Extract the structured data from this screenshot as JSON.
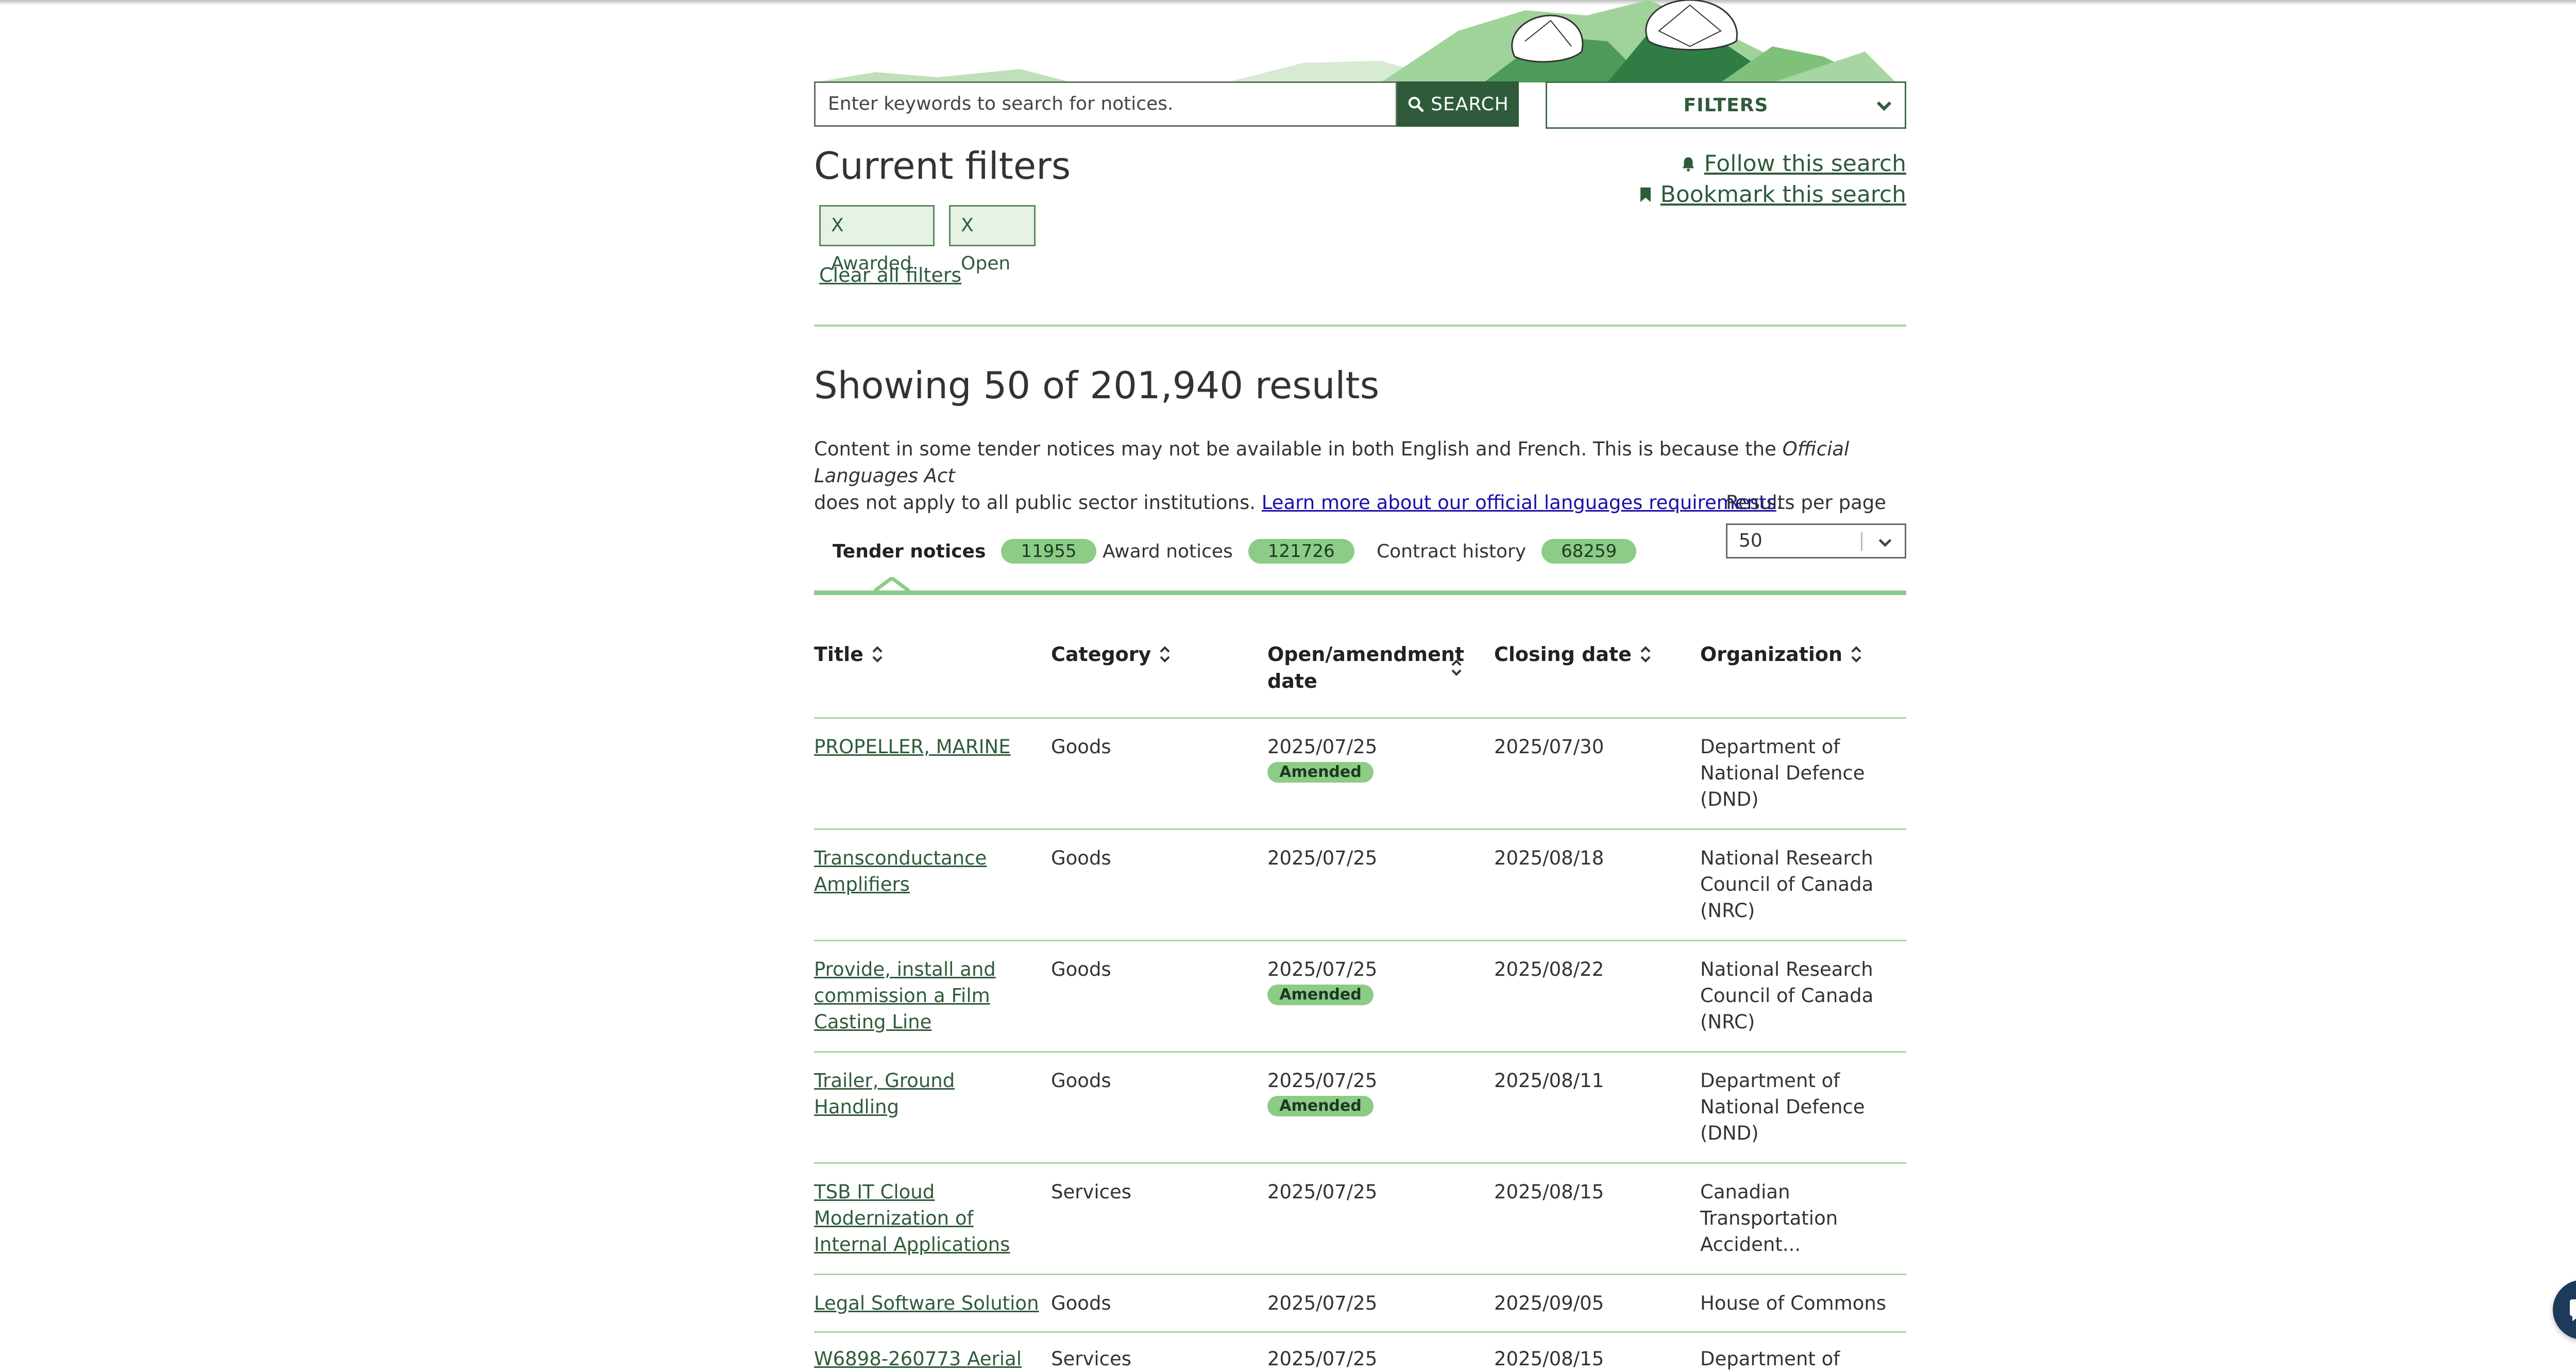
{
  "search": {
    "placeholder": "Enter keywords to search for notices.",
    "button_label": "SEARCH"
  },
  "filters_button": "FILTERS",
  "current_filters": {
    "title": "Current filters",
    "chips": [
      "X Awarded",
      "X Open"
    ],
    "clear_label": "Clear all filters",
    "follow_label": "Follow this search",
    "bookmark_label": "Bookmark this search"
  },
  "results": {
    "heading": "Showing 50 of 201,940 results",
    "notice_part1": "Content in some tender notices may not be available in both English and French. This is because the ",
    "notice_italic": "Official Languages Act",
    "notice_part2": " does not apply to all public sector institutions. ",
    "notice_link": "Learn more about our official languages requirements",
    "notice_end": ".",
    "per_page_label": "Results per page",
    "per_page_value": "50"
  },
  "tabs": [
    {
      "label": "Tender notices",
      "count": "11955",
      "active": true
    },
    {
      "label": "Award notices",
      "count": "121726",
      "active": false
    },
    {
      "label": "Contract history",
      "count": "68259",
      "active": false
    }
  ],
  "table": {
    "headers": [
      "Title",
      "Category",
      "Open/amendment date",
      "Closing date",
      "Organization"
    ],
    "amended_label": "Amended",
    "rows": [
      {
        "title": "PROPELLER, MARINE",
        "category": "Goods",
        "open_date": "2025/07/25",
        "amended": true,
        "closing": "2025/07/30",
        "org": "Department of National Defence (DND)"
      },
      {
        "title": "Transconductance Amplifiers",
        "category": "Goods",
        "open_date": "2025/07/25",
        "amended": false,
        "closing": "2025/08/18",
        "org": "National Research Council of Canada (NRC)"
      },
      {
        "title": "Provide, install and commission a Film Casting Line",
        "category": "Goods",
        "open_date": "2025/07/25",
        "amended": true,
        "closing": "2025/08/22",
        "org": "National Research Council of Canada (NRC)"
      },
      {
        "title": "Trailer, Ground Handling",
        "category": "Goods",
        "open_date": "2025/07/25",
        "amended": true,
        "closing": "2025/08/11",
        "org": "Department of National Defence (DND)"
      },
      {
        "title": "TSB IT Cloud Modernization of Internal Applications",
        "category": "Services",
        "open_date": "2025/07/25",
        "amended": false,
        "closing": "2025/08/15",
        "org": "Canadian Transportation Accident..."
      },
      {
        "title": "Legal Software Solution",
        "category": "Goods",
        "open_date": "2025/07/25",
        "amended": false,
        "closing": "2025/09/05",
        "org": "House of Commons"
      },
      {
        "title": "W6898-260773 Aerial",
        "category": "Services",
        "open_date": "2025/07/25",
        "amended": false,
        "closing": "2025/08/15",
        "org": "Department of"
      }
    ]
  },
  "colors": {
    "accent_green": "#2f5b3b",
    "badge_green": "#8ccc86",
    "rule_green": "#a9d5a5",
    "chat_blue": "#1c3b5a"
  }
}
